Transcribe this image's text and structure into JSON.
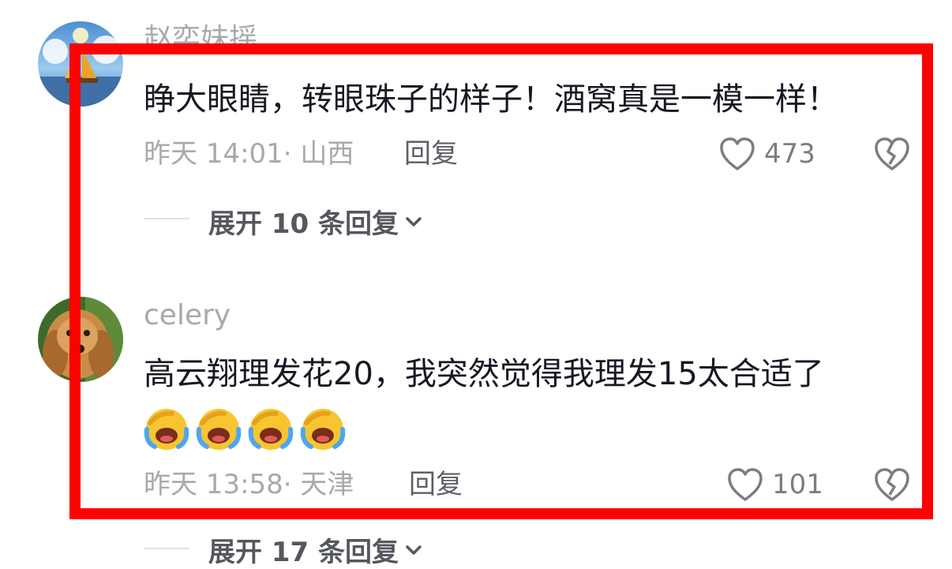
{
  "comments": [
    {
      "username": "赵奕妹摇",
      "text": "睁大眼睛，转眼珠子的样子！酒窝真是一模一样！",
      "meta": "昨天 14:01· 山西",
      "reply_label": "回复",
      "like_count": "473",
      "expand_label": "展开 10 条回复"
    },
    {
      "username": "celery",
      "text": "高云翔理发花20，我突然觉得我理发15太合适了",
      "emoji_count": 4,
      "meta": "昨天 13:58· 天津",
      "reply_label": "回复",
      "like_count": "101",
      "expand_label": "展开 17 条回复"
    }
  ],
  "icons": {
    "like": "heart-outline-icon",
    "dislike": "broken-heart-icon",
    "expand": "chevron-down-icon",
    "emoji": "laughing-crying-emoji"
  },
  "colors": {
    "highlight_frame": "#ff0000",
    "username": "#a9a9ad",
    "text": "#161823",
    "meta": "#a8a8ad"
  }
}
